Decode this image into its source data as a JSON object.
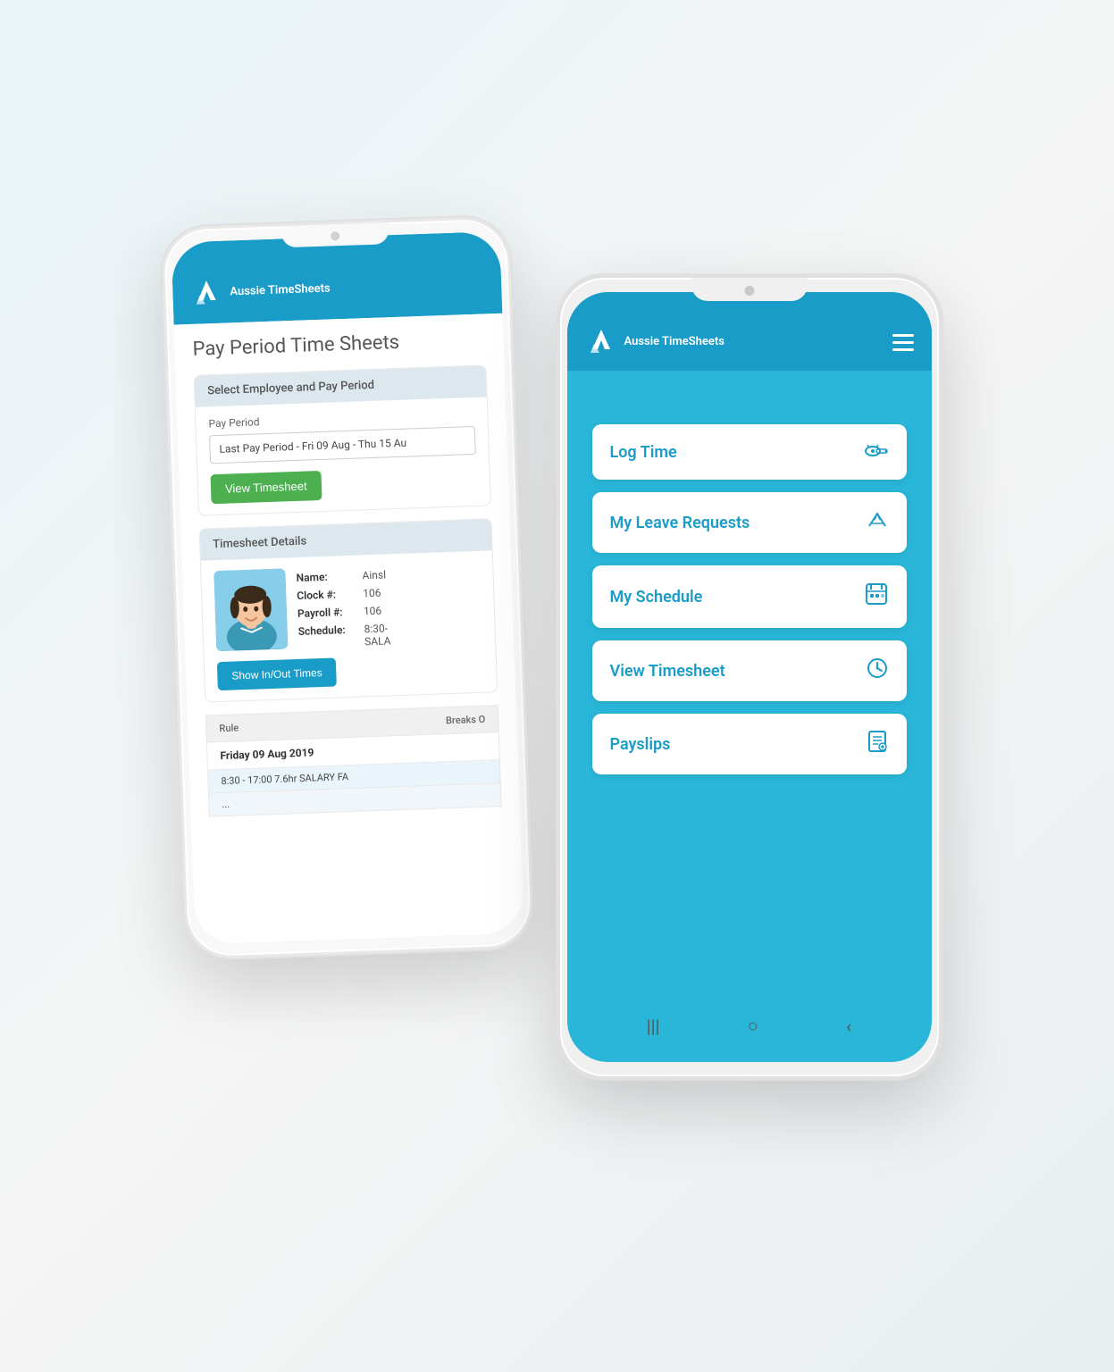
{
  "back_phone": {
    "brand": "Aussie\nTimeSheets",
    "page_title": "Pay Period Time Sheets",
    "section1": {
      "header": "Select Employee and Pay Period",
      "pay_period_label": "Pay Period",
      "pay_period_value": "Last Pay Period - Fri 09 Aug - Thu 15 Au",
      "view_button": "View Timesheet"
    },
    "section2": {
      "header": "Timesheet Details",
      "name_key": "Name:",
      "name_val": "Ainsl",
      "clock_key": "Clock #:",
      "clock_val": "106",
      "payroll_key": "Payroll #:",
      "payroll_val": "106",
      "schedule_key": "Schedule:",
      "schedule_val": "8:30-",
      "schedule_val2": "SALA",
      "show_button": "Show In/Out Times"
    },
    "table": {
      "col1": "Rule",
      "col2": "Breaks O",
      "date_row": "Friday 09 Aug 2019",
      "time_row": "8:30 - 17:00 7.6hr SALARY FA"
    }
  },
  "front_phone": {
    "brand": "Aussie\nTimeSheets",
    "menu_items": [
      {
        "label": "Log Time",
        "icon": "🗝️"
      },
      {
        "label": "My Leave Requests",
        "icon": "✈️"
      },
      {
        "label": "My Schedule",
        "icon": "📅"
      },
      {
        "label": "View Timesheet",
        "icon": "⏱️"
      },
      {
        "label": "Payslips",
        "icon": "📋"
      }
    ],
    "bottom_bar": {
      "bars": "|||",
      "circle": "○",
      "back": "<"
    }
  }
}
